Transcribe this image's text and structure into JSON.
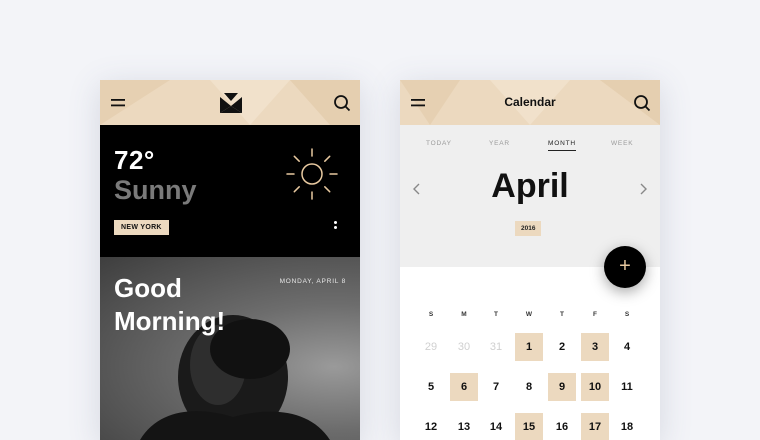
{
  "weather_screen": {
    "temperature": "72°",
    "condition": "Sunny",
    "city": "NEW YORK",
    "greeting": "Good Morning!",
    "date": "MONDAY, APRIL 8"
  },
  "calendar_screen": {
    "title": "Calendar",
    "tabs": [
      {
        "label": "TODAY",
        "active": false
      },
      {
        "label": "YEAR",
        "active": false
      },
      {
        "label": "MONTH",
        "active": true
      },
      {
        "label": "WEEK",
        "active": false
      }
    ],
    "month": "April",
    "year": "2016",
    "add_label": "+",
    "weekdays": [
      "S",
      "M",
      "T",
      "W",
      "T",
      "F",
      "S"
    ],
    "weeks": [
      [
        {
          "d": "29",
          "muted": true
        },
        {
          "d": "30",
          "muted": true
        },
        {
          "d": "31",
          "muted": true
        },
        {
          "d": "1",
          "hl": true
        },
        {
          "d": "2"
        },
        {
          "d": "3",
          "hl": true
        },
        {
          "d": "4"
        }
      ],
      [
        {
          "d": "5"
        },
        {
          "d": "6",
          "hl": true
        },
        {
          "d": "7"
        },
        {
          "d": "8"
        },
        {
          "d": "9",
          "hl": true
        },
        {
          "d": "10",
          "hl": true
        },
        {
          "d": "11"
        }
      ],
      [
        {
          "d": "12"
        },
        {
          "d": "13"
        },
        {
          "d": "14"
        },
        {
          "d": "15",
          "hl": true
        },
        {
          "d": "16"
        },
        {
          "d": "17",
          "hl": true
        },
        {
          "d": "18"
        }
      ]
    ]
  },
  "colors": {
    "accent": "#ecd9bf",
    "background": "#f3f4f8",
    "dark": "#000000"
  },
  "icons": [
    "menu-icon",
    "logo-icon",
    "search-icon",
    "sun-icon",
    "more-icon",
    "chevron-left-icon",
    "chevron-right-icon",
    "plus-icon"
  ]
}
